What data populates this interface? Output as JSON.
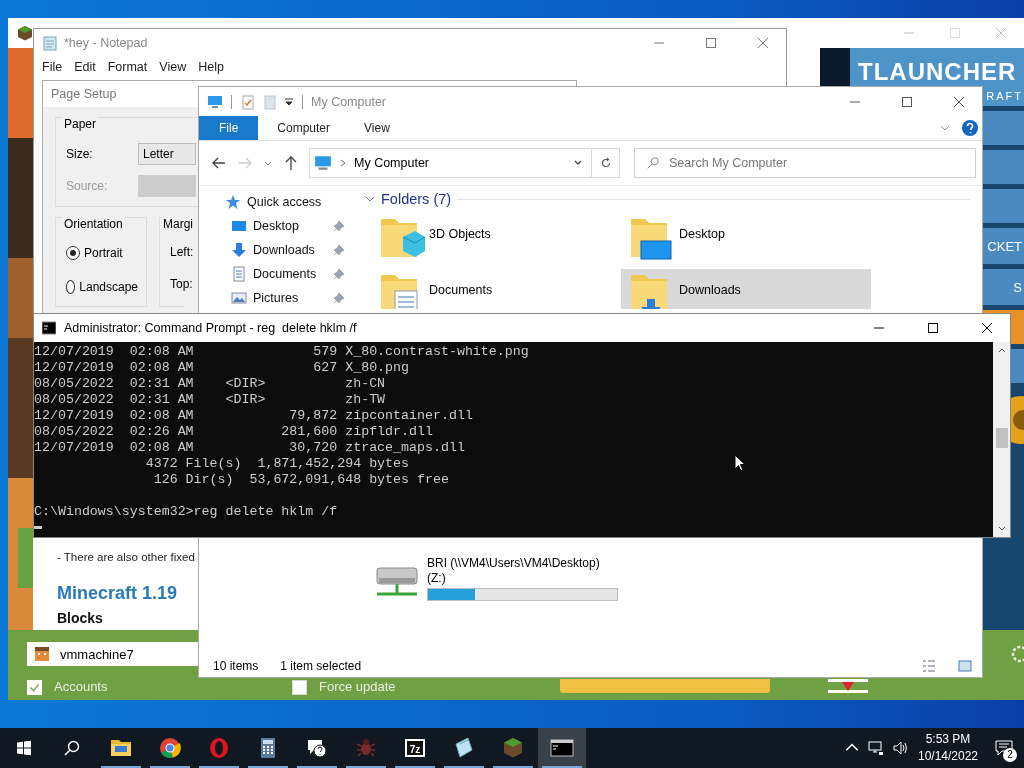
{
  "launcher": {
    "brand": "TLAUNCHER",
    "brand_sub": "RAFT",
    "menu_labels": [
      "CKET",
      "S"
    ],
    "news": [
      "- There are also other fixed"
    ],
    "heading": "Minecraft 1.19",
    "section": "Blocks",
    "username": "vmmachine7",
    "options": [
      {
        "label": "Accounts",
        "checked": true
      },
      {
        "label": "Force update",
        "checked": false
      }
    ]
  },
  "notepad": {
    "title": "*hey - Notepad",
    "menu": [
      "File",
      "Edit",
      "Format",
      "View",
      "Help"
    ]
  },
  "page_setup": {
    "title": "Page Setup",
    "paper_group": "Paper",
    "size_label": "Size:",
    "size_value": "Letter",
    "source_label": "Source:",
    "orientation_group": "Orientation",
    "orientations": [
      {
        "label": "Portrait",
        "selected": true
      },
      {
        "label": "Landscape",
        "selected": false
      }
    ],
    "margins_group": "Margi",
    "margin_labels": [
      "Left:",
      "Top:"
    ]
  },
  "explorer": {
    "title": "My Computer",
    "ribbon_tabs": [
      {
        "label": "File",
        "selected": true
      },
      {
        "label": "Computer",
        "selected": false
      },
      {
        "label": "View",
        "selected": false
      }
    ],
    "address": "My Computer",
    "search": {
      "placeholder": "Search My Computer"
    },
    "nav": [
      {
        "kind": "star",
        "label": "Quick access",
        "pinned": false
      },
      {
        "kind": "desktop",
        "label": "Desktop",
        "pinned": true
      },
      {
        "kind": "downloads",
        "label": "Downloads",
        "pinned": true
      },
      {
        "kind": "documents",
        "label": "Documents",
        "pinned": true
      },
      {
        "kind": "pictures",
        "label": "Pictures",
        "pinned": true
      }
    ],
    "folders_header": "Folders (7)",
    "folders": [
      {
        "kind": "cube",
        "label": "3D Objects",
        "selected": false
      },
      {
        "kind": "desktop",
        "label": "Desktop",
        "selected": false
      },
      {
        "kind": "documents",
        "label": "Documents",
        "selected": false
      },
      {
        "kind": "downloads",
        "label": "Downloads",
        "selected": true
      }
    ],
    "drive": {
      "name": "BRI (\\\\VM4\\Users\\VM4\\Desktop)",
      "letter": "(Z:)",
      "level": 0.25
    },
    "status": [
      "10 items",
      "1 item selected"
    ]
  },
  "cmd": {
    "title": "Administrator: Command Prompt - reg  delete hklm /f",
    "lines": [
      "12/07/2019  02:08 AM               579 X_80.contrast-white.png",
      "12/07/2019  02:08 AM               627 X_80.png",
      "08/05/2022  02:31 AM    <DIR>          zh-CN",
      "08/05/2022  02:31 AM    <DIR>          zh-TW",
      "12/07/2019  02:08 AM            79,872 zipcontainer.dll",
      "08/05/2022  02:26 AM           281,600 zipfldr.dll",
      "12/07/2019  02:08 AM            30,720 ztrace_maps.dll",
      "              4372 File(s)  1,871,452,294 bytes",
      "               126 Dir(s)  53,672,091,648 bytes free"
    ],
    "prompt": "C:\\Windows\\system32>reg delete hklm /f"
  },
  "taskbar": {
    "apps": [
      {
        "kind": "folder",
        "selected": false
      },
      {
        "kind": "chrome",
        "selected": false
      },
      {
        "kind": "opera",
        "selected": false
      },
      {
        "kind": "calculator",
        "selected": false
      },
      {
        "kind": "help",
        "selected": false
      },
      {
        "kind": "bug",
        "selected": false
      },
      {
        "kind": "archive",
        "label": "7z",
        "selected": false
      },
      {
        "kind": "notepad",
        "selected": false
      },
      {
        "kind": "grass",
        "selected": false
      },
      {
        "kind": "console",
        "selected": true
      }
    ],
    "time": "5:53 PM",
    "date": "10/14/2022",
    "notifications": "2"
  }
}
